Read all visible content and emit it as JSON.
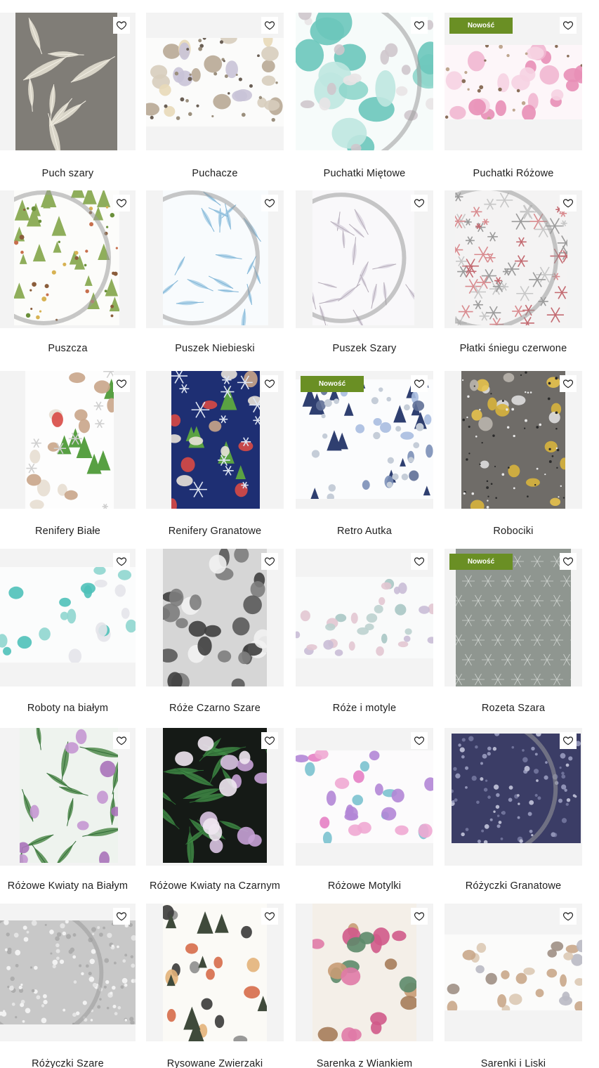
{
  "colors": {
    "badge_bg": "#6a8f24",
    "badge_text": "#ffffff",
    "thumb_bg": "#f3f3f3",
    "text": "#1e1e1e"
  },
  "badge_label": "Nowość",
  "icons": {
    "favorite": "heart-outline-icon"
  },
  "products": [
    {
      "name": "Puch szary",
      "badge": false,
      "pattern": "feathers-grey"
    },
    {
      "name": "Puchacze",
      "badge": false,
      "pattern": "owls"
    },
    {
      "name": "Puchatki Miętowe",
      "badge": false,
      "pattern": "bears-mint"
    },
    {
      "name": "Puchatki Różowe",
      "badge": true,
      "pattern": "bears-pink"
    },
    {
      "name": "Puszcza",
      "badge": false,
      "pattern": "forest"
    },
    {
      "name": "Puszek Niebieski",
      "badge": false,
      "pattern": "feathers-blue"
    },
    {
      "name": "Puszek Szary",
      "badge": false,
      "pattern": "feathers-grey-light"
    },
    {
      "name": "Płatki śniegu czerwone",
      "badge": false,
      "pattern": "snowflakes-red"
    },
    {
      "name": "Renifery Białe",
      "badge": false,
      "pattern": "reindeer-white"
    },
    {
      "name": "Renifery Granatowe",
      "badge": false,
      "pattern": "reindeer-navy"
    },
    {
      "name": "Retro Autka",
      "badge": true,
      "pattern": "retro-cars"
    },
    {
      "name": "Robociki",
      "badge": false,
      "pattern": "robots-grey"
    },
    {
      "name": "Roboty na białym",
      "badge": false,
      "pattern": "robots-white"
    },
    {
      "name": "Róże Czarno Szare",
      "badge": false,
      "pattern": "roses-grey"
    },
    {
      "name": "Róże i motyle",
      "badge": false,
      "pattern": "roses-butterflies"
    },
    {
      "name": "Rozeta Szara",
      "badge": true,
      "pattern": "rosette-grey"
    },
    {
      "name": "Różowe Kwiaty na Białym",
      "badge": false,
      "pattern": "flowers-white"
    },
    {
      "name": "Różowe Kwiaty na Czarnym",
      "badge": false,
      "pattern": "flowers-black"
    },
    {
      "name": "Różowe Motylki",
      "badge": false,
      "pattern": "butterflies-pink"
    },
    {
      "name": "Różyczki Granatowe",
      "badge": false,
      "pattern": "roses-navy"
    },
    {
      "name": "Różyczki Szare",
      "badge": false,
      "pattern": "roses-small-grey"
    },
    {
      "name": "Rysowane Zwierzaki",
      "badge": false,
      "pattern": "drawn-animals"
    },
    {
      "name": "Sarenka z Wiankiem",
      "badge": false,
      "pattern": "fawn-wreath"
    },
    {
      "name": "Sarenki i Liski",
      "badge": false,
      "pattern": "deer-foxes"
    }
  ]
}
